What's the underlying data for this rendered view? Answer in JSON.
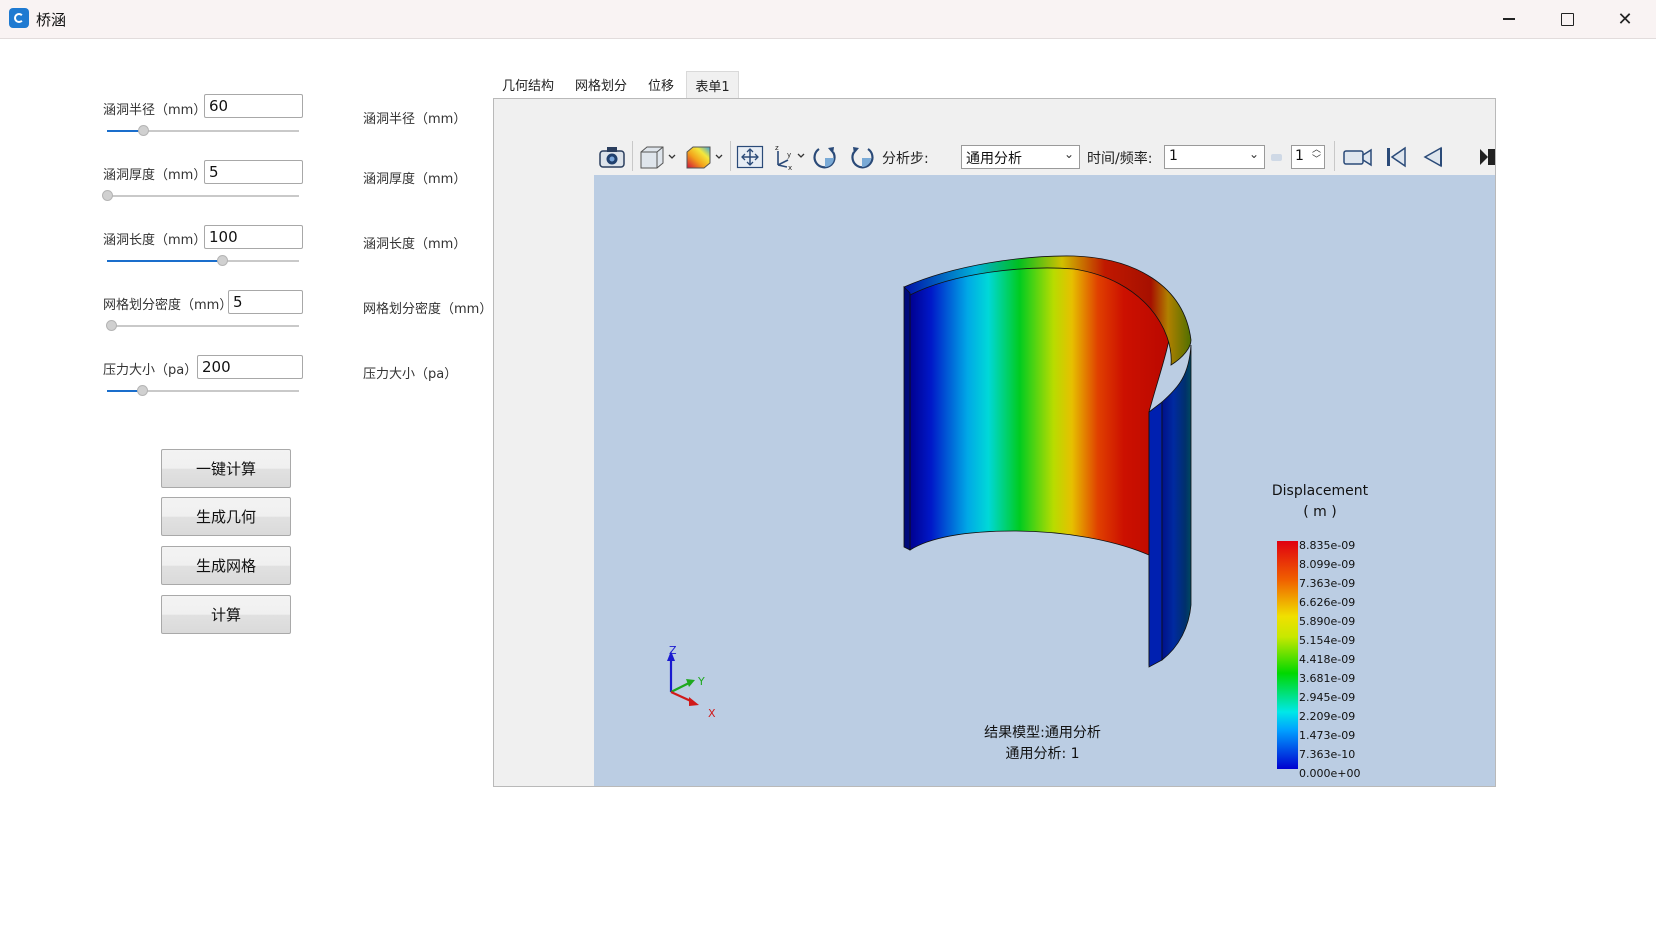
{
  "window": {
    "title": "桥涵"
  },
  "params": [
    {
      "label": "涵洞半径（mm）",
      "value": "60",
      "slider": 0.19
    },
    {
      "label": "涵洞厚度（mm）",
      "value": "5",
      "slider": 0.0
    },
    {
      "label": "涵洞长度（mm）",
      "value": "100",
      "slider": 0.6
    },
    {
      "label": "网格划分密度（mm）",
      "value": "5",
      "slider": 0.02
    },
    {
      "label": "压力大小（pa）",
      "value": "200",
      "slider": 0.18
    }
  ],
  "buttons": {
    "one_click": "一键计算",
    "gen_geometry": "生成几何",
    "gen_mesh": "生成网格",
    "compute": "计算"
  },
  "mid_labels": [
    "涵洞半径（mm）",
    "涵洞厚度（mm）",
    "涵洞长度（mm）",
    "网格划分密度（mm）",
    "压力大小（pa）"
  ],
  "tabs": [
    "几何结构",
    "网格划分",
    "位移",
    "表单1"
  ],
  "active_tab": "表单1",
  "toolbar": {
    "step_label": "分析步:",
    "step_value": "通用分析",
    "time_label": "时间/频率:",
    "time_value": "1",
    "spin_value": "1"
  },
  "legend": {
    "title_line1": "Displacement",
    "title_line2": "( m )",
    "values": [
      "8.835e-09",
      "8.099e-09",
      "7.363e-09",
      "6.626e-09",
      "5.890e-09",
      "5.154e-09",
      "4.418e-09",
      "3.681e-09",
      "2.945e-09",
      "2.209e-09",
      "1.473e-09",
      "7.363e-10",
      "0.000e+00"
    ]
  },
  "result": {
    "line1": "结果模型:通用分析",
    "line2": "通用分析: 1"
  },
  "triad": {
    "x": "X",
    "y": "Y",
    "z": "Z"
  },
  "colors": {
    "viewport_bg": "#bbcde3",
    "slider_fill": "#1a6ecc"
  }
}
